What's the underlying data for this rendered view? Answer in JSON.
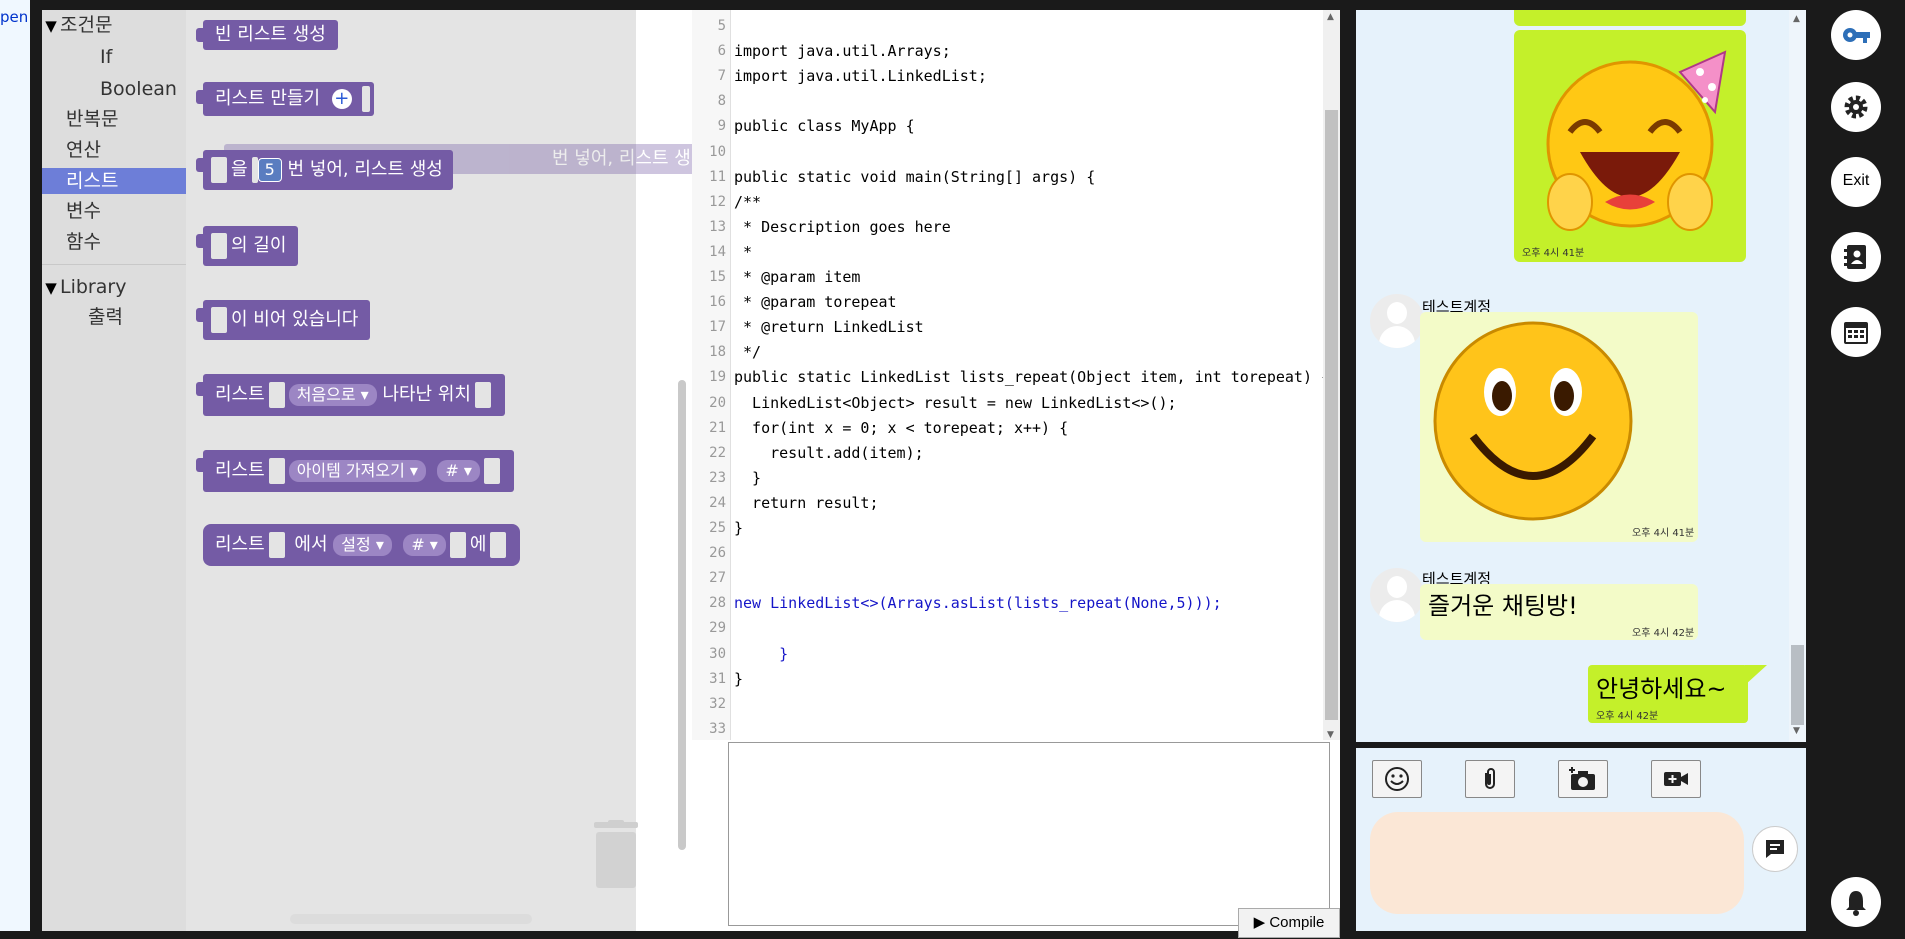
{
  "left_strip": {
    "text": "pen"
  },
  "toolbox": {
    "categories": [
      {
        "label": "조건문"
      },
      {
        "label": "If"
      },
      {
        "label": "Boolean"
      },
      {
        "label": "반복문"
      },
      {
        "label": "연산"
      },
      {
        "label": "리스트"
      },
      {
        "label": "변수"
      },
      {
        "label": "함수"
      },
      {
        "label": "Library"
      },
      {
        "label": "출력"
      }
    ],
    "selected": "리스트"
  },
  "blocks": {
    "empty_list": "빈 리스트 생성",
    "make_list": "리스트 만들기",
    "repeat_a": "을",
    "repeat_num": "5",
    "repeat_b": "번 넣어, 리스트 생성",
    "repeat_ghost": "번 넣어, 리스트 생",
    "length": "의 길이",
    "is_empty": "이 비어 있습니다",
    "indexof_a": "리스트",
    "indexof_dd": "처음으로",
    "indexof_b": "나타난 위치",
    "getitem_a": "리스트",
    "getitem_dd": "아이템 가져오기",
    "getitem_hash": "#",
    "setitem_a": "리스트",
    "setitem_b": "에서",
    "setitem_dd": "설정",
    "setitem_hash": "#",
    "setitem_c": "에"
  },
  "editor": {
    "line_numbers": [
      "5",
      "6",
      "7",
      "8",
      "9",
      "10",
      "11",
      "12",
      "13",
      "14",
      "15",
      "16",
      "17",
      "18",
      "19",
      "20",
      "21",
      "22",
      "23",
      "24",
      "25",
      "26",
      "27",
      "28",
      "29",
      "30",
      "31",
      "32",
      "33"
    ],
    "lines": [
      "",
      "import java.util.Arrays;",
      "import java.util.LinkedList;",
      "",
      "public class MyApp {",
      "",
      "public static void main(String[] args) {",
      "/**",
      " * Description goes here",
      " *",
      " * @param item",
      " * @param torepeat",
      " * @return LinkedList",
      " */",
      "public static LinkedList lists_repeat(Object item, int torepeat) {",
      "  LinkedList<Object> result = new LinkedList<>();",
      "  for(int x = 0; x < torepeat; x++) {",
      "    result.add(item);",
      "  }",
      "  return result;",
      "}",
      "",
      "",
      "new LinkedList<>(Arrays.asList(lists_repeat(None,5)));",
      "",
      "     }",
      "}",
      "",
      ""
    ],
    "compile_label": "▶ Compile"
  },
  "chat": {
    "messages": [
      {
        "time": "오후 4시 41분"
      },
      {
        "user": "테스트계정",
        "time": "오후 4시 41분"
      },
      {
        "user": "테스트계정",
        "text": "즐거운 채팅방!",
        "time": "오후 4시 42분"
      },
      {
        "text": "안녕하세요~",
        "time": "오후 4시 42분"
      }
    ],
    "input_placeholder": "",
    "tools": [
      "emoji-icon",
      "paperclip-icon",
      "camera-add-icon",
      "video-icon"
    ]
  },
  "sidebar": {
    "exit_label": "Exit",
    "icons": [
      "key-icon",
      "gear-icon",
      "exit-button",
      "contacts-icon",
      "calendar-icon",
      "bell-icon"
    ]
  },
  "colors": {
    "block": "#745ba5",
    "selected_category": "#6d7ed8",
    "my_bubble": "#c4f02a",
    "their_bubble": "#f3fbc8",
    "chat_bg": "#e6f2fb"
  }
}
